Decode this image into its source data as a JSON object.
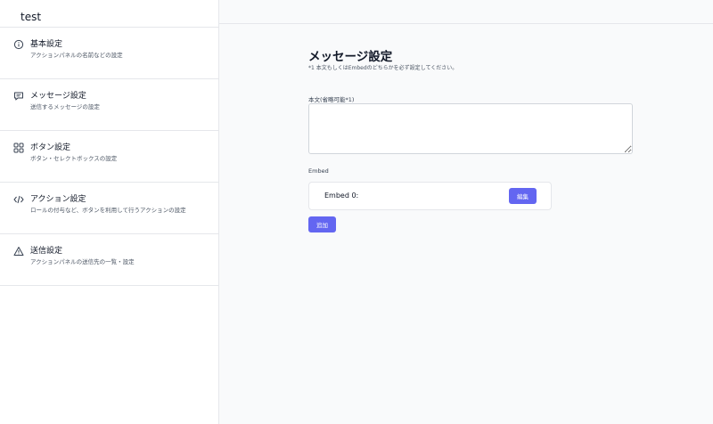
{
  "app": {
    "title": "test"
  },
  "sidebar": {
    "items": [
      {
        "icon": "info-icon",
        "title": "基本設定",
        "desc": "アクションパネルの名前などの設定"
      },
      {
        "icon": "message-icon",
        "title": "メッセージ設定",
        "desc": "送信するメッセージの設定"
      },
      {
        "icon": "grid-icon",
        "title": "ボタン設定",
        "desc": "ボタン・セレクトボックスの設定"
      },
      {
        "icon": "code-icon",
        "title": "アクション設定",
        "desc": "ロールの付与など、ボタンを利用して行うアクションの設定"
      },
      {
        "icon": "warning-icon",
        "title": "送信設定",
        "desc": "アクションパネルの送信先の一覧・設定"
      }
    ]
  },
  "main": {
    "title": "メッセージ設定",
    "note": "*1 本文もしくはEmbedのどちらかを必ず設定してください。",
    "body_label": "本文(省略可能*1)",
    "body_value": "",
    "embed_label": "Embed",
    "embeds": [
      {
        "name": "Embed 0:",
        "edit_label": "編集"
      }
    ],
    "add_label": "追加"
  },
  "colors": {
    "accent": "#6366f1",
    "border": "#e5e7eb",
    "main_bg": "#f9fafb"
  }
}
